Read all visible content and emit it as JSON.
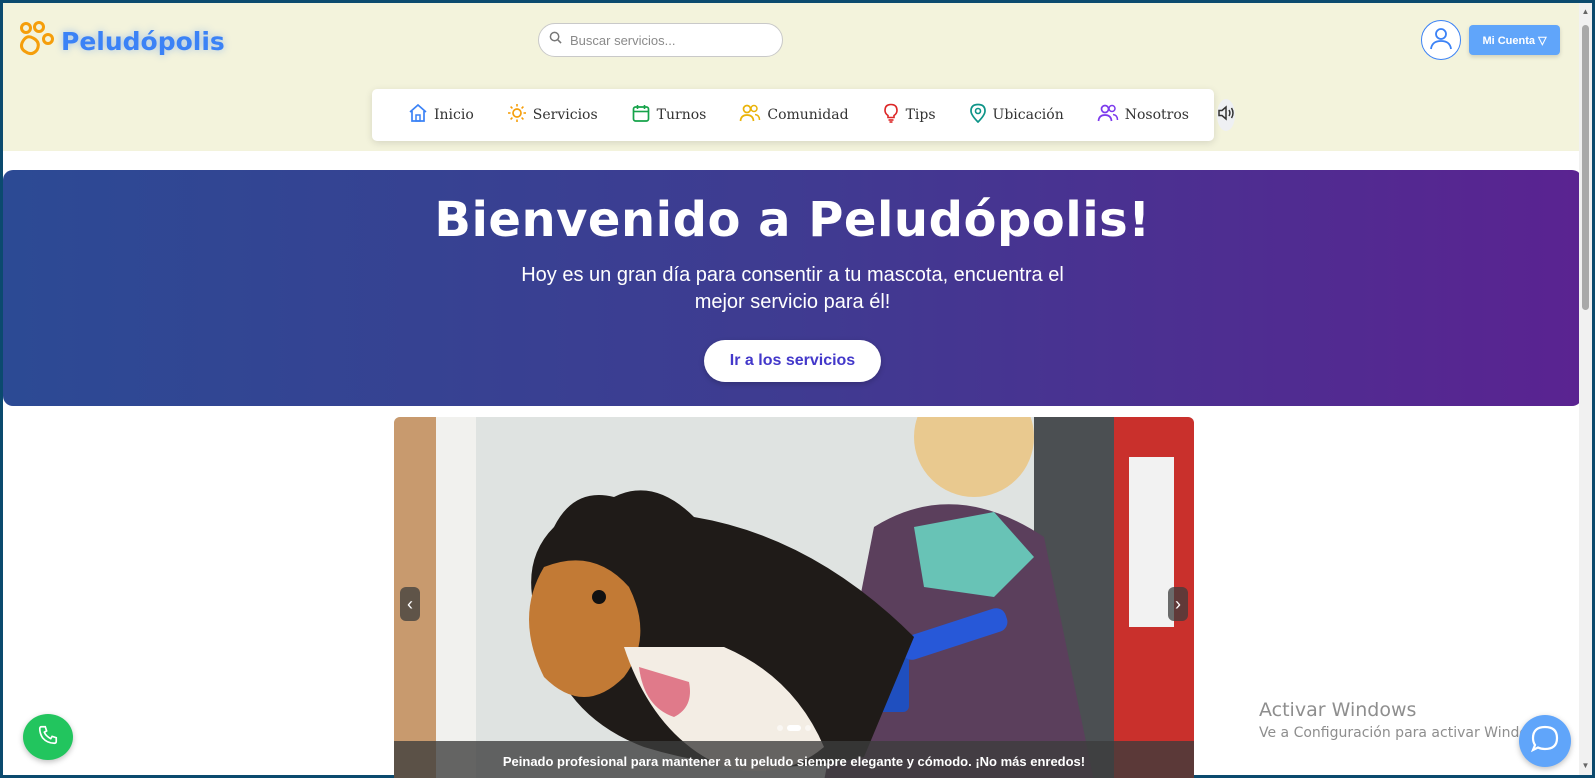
{
  "brand": {
    "name": "Peludópolis",
    "color": "#3b82f6",
    "paw_color": "#f59e0b"
  },
  "search": {
    "placeholder": "Buscar servicios..."
  },
  "account": {
    "label": "Mi Cuenta ▽"
  },
  "nav": {
    "items": [
      {
        "label": "Inicio",
        "icon": "home-icon",
        "color": "#3b82f6"
      },
      {
        "label": "Servicios",
        "icon": "sun-icon",
        "color": "#f59e0b"
      },
      {
        "label": "Turnos",
        "icon": "calendar-icon",
        "color": "#16a34a"
      },
      {
        "label": "Comunidad",
        "icon": "users-icon",
        "color": "#eab308"
      },
      {
        "label": "Tips",
        "icon": "lightbulb-icon",
        "color": "#dc2626"
      },
      {
        "label": "Ubicación",
        "icon": "map-pin-icon",
        "color": "#0d9488"
      },
      {
        "label": "Nosotros",
        "icon": "team-icon",
        "color": "#7c3aed"
      }
    ],
    "sound_icon": "speaker-icon"
  },
  "hero": {
    "title": "Bienvenido a Peludópolis!",
    "subtitle": "Hoy es un gran día para consentir a tu mascota, encuentra el mejor servicio para él!",
    "button": "Ir a los servicios",
    "gradient": [
      "#2c4a94",
      "#5a2391"
    ]
  },
  "carousel": {
    "caption": "Peinado profesional para mantener a tu peludo siempre elegante y cómodo. ¡No más enredos!",
    "prev": "‹",
    "next": "›",
    "slides": 3,
    "active_slide": 2
  },
  "watermark": {
    "line1": "Activar Windows",
    "line2": "Ve a Configuración para activar Windows."
  }
}
